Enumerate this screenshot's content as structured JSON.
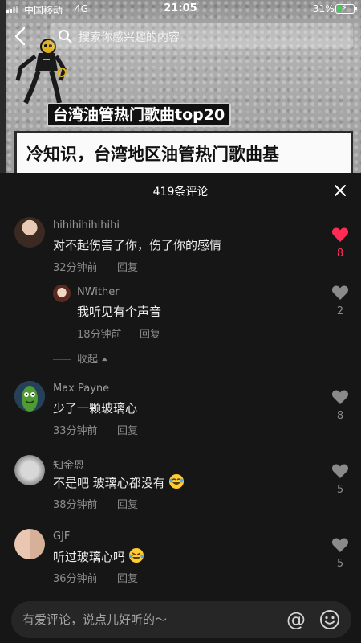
{
  "status_bar": {
    "carrier": "中国移动",
    "network": "4G",
    "time": "21:05",
    "battery": "31%",
    "battery_level": 0.31
  },
  "search": {
    "placeholder": "搜索你感兴趣的内容"
  },
  "video": {
    "banner_title": "台湾油管热门歌曲top20",
    "banner_subtitle": "冷知识，台湾地区油管热门歌曲基"
  },
  "comments_panel": {
    "title": "419条评论",
    "collapse_label": "收起",
    "comments": [
      {
        "user": "hihihihihihihi",
        "text": "对不起伤害了你，伤了你的感情",
        "time": "32分钟前",
        "reply": "回复",
        "likes": "8",
        "liked": true
      },
      {
        "user": "NWither",
        "text": "我听见有个声音",
        "time": "18分钟前",
        "reply": "回复",
        "likes": "2",
        "liked": false
      },
      {
        "user": "Max Payne",
        "text": "少了一颗玻璃心",
        "time": "33分钟前",
        "reply": "回复",
        "likes": "8",
        "liked": false
      },
      {
        "user": "知金恩",
        "text": "不是吧 玻璃心都没有",
        "time": "38分钟前",
        "reply": "回复",
        "likes": "5",
        "liked": false,
        "emoji": "rofl-emoji"
      },
      {
        "user": "GJF",
        "text": "听过玻璃心吗",
        "time": "36分钟前",
        "reply": "回复",
        "likes": "5",
        "liked": false,
        "emoji": "laughing-tears-emoji"
      }
    ]
  },
  "input": {
    "placeholder": "有爱评论，说点儿好听的～"
  },
  "colors": {
    "like_active": "#fe2c55",
    "panel_bg": "#161616",
    "input_bg": "#262626"
  },
  "icons": [
    "back-arrow-icon",
    "search-icon",
    "close-icon",
    "heart-icon",
    "at-icon",
    "emoji-icon",
    "caret-up-icon"
  ]
}
